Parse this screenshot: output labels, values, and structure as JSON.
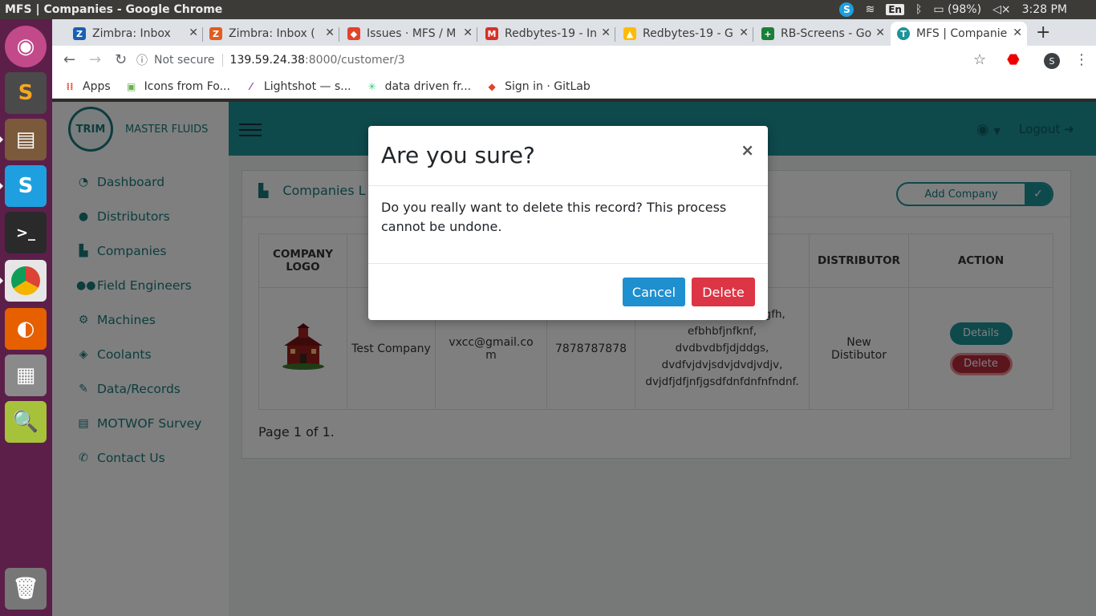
{
  "os": {
    "window_title": "MFS | Companies - Google Chrome",
    "lang": "En",
    "battery": "(98%)",
    "clock": "3:28 PM"
  },
  "browser": {
    "tabs": [
      {
        "label": "Zimbra: Inbox",
        "fav": "Z",
        "color": "#1a5fb4"
      },
      {
        "label": "Zimbra: Inbox (",
        "fav": "Z",
        "color": "#e05d20"
      },
      {
        "label": "Issues · MFS / M",
        "fav": "G",
        "color": "#e2432a"
      },
      {
        "label": "Redbytes-19 - In",
        "fav": "M",
        "color": "#d93025"
      },
      {
        "label": "Redbytes-19 - G",
        "fav": "D",
        "color": "#fbbc04"
      },
      {
        "label": "RB-Screens - Go",
        "fav": "+",
        "color": "#188038"
      },
      {
        "label": "MFS | Companie",
        "fav": "T",
        "color": "#1d9399"
      }
    ],
    "not_secure": "Not secure",
    "url_host": "139.59.24.38",
    "url_rest": ":8000/customer/3",
    "profile_initial": "S",
    "bookmarks": [
      {
        "label": "Apps",
        "icon": "apps-grid-icon"
      },
      {
        "label": "Icons from Fo...",
        "icon": "fontawesome-icon"
      },
      {
        "label": "Lightshot — s...",
        "icon": "feather-icon"
      },
      {
        "label": "data driven fr...",
        "icon": "d3-icon"
      },
      {
        "label": "Sign in · GitLab",
        "icon": "gitlab-icon"
      }
    ]
  },
  "app": {
    "logo_text": "TRIM",
    "brand": "MASTER FLUIDS",
    "menu": [
      {
        "label": "Dashboard",
        "icon": "dashboard-icon"
      },
      {
        "label": "Distributors",
        "icon": "user-icon"
      },
      {
        "label": "Companies",
        "icon": "industry-icon"
      },
      {
        "label": "Field Engineers",
        "icon": "users-icon"
      },
      {
        "label": "Machines",
        "icon": "cogs-icon"
      },
      {
        "label": "Coolants",
        "icon": "fill-drip-icon"
      },
      {
        "label": "Data/Records",
        "icon": "edit-icon"
      },
      {
        "label": "MOTWOF Survey",
        "icon": "list-icon"
      },
      {
        "label": "Contact Us",
        "icon": "phone-icon"
      }
    ],
    "logout": "Logout",
    "card_title": "Companies L",
    "add_company": "Add Company",
    "table": {
      "headers": [
        "COMPANY LOGO",
        "",
        "",
        "",
        "",
        "DISTRIBUTOR",
        "ACTION"
      ],
      "row": {
        "name": "Test Company",
        "email": "vxcc@gmail.com",
        "phone": "7878787878",
        "address": "rgfgvbvnb, rfhfhfghgfh, efbhbfjnfknf, dvdbvdbfjdjddgs, dvdfvjdvjsdvjdvdjvdjv, dvjdfjdfjnfjgsdfdnfdnfnfndnf.",
        "distributor": "New Distibutor",
        "details": "Details",
        "delete": "Delete"
      }
    },
    "pager": "Page 1 of 1."
  },
  "modal": {
    "title": "Are you sure?",
    "close": "×",
    "body": "Do you really want to delete this record? This process cannot be undone.",
    "cancel": "Cancel",
    "delete": "Delete"
  }
}
